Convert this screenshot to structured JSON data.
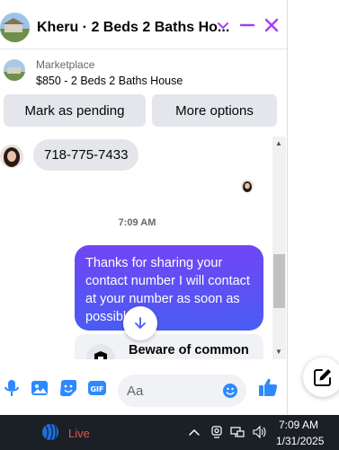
{
  "header": {
    "title": "Kheru · 2 Beds 2 Baths Ho...",
    "accent": "#a142f4"
  },
  "listing": {
    "source": "Marketplace",
    "title": "$850 - 2 Beds 2 Baths House"
  },
  "actions": {
    "mark_pending": "Mark as pending",
    "more_options": "More options"
  },
  "messages": {
    "incoming_text": "718-775-7433",
    "timestamp": "7:09 AM",
    "outgoing_text": "Thanks for sharing your contact number I will contact at your number as soon as possible",
    "warning_text": "Beware of common"
  },
  "composer": {
    "placeholder": "Aa"
  },
  "taskbar": {
    "live_label": "Live",
    "time": "7:09 AM",
    "date": "1/31/2025"
  },
  "colors": {
    "bubble_out_top": "#7145f5",
    "bubble_out_bottom": "#4a5cf4",
    "messenger_blue": "#2e89ff",
    "live_red": "#e25151"
  }
}
